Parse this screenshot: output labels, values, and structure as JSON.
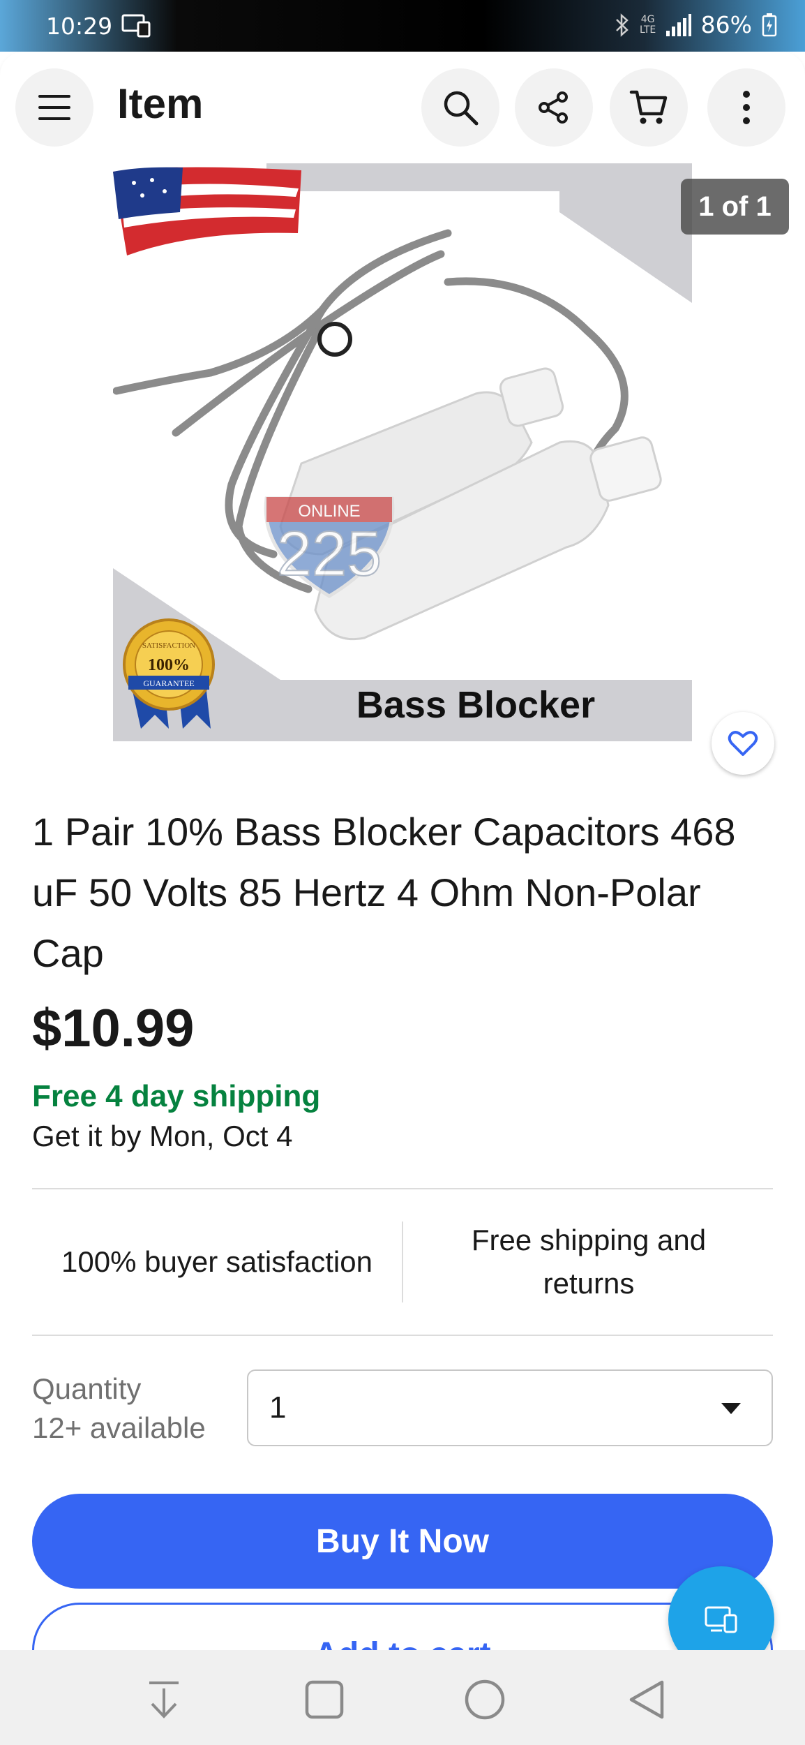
{
  "status_bar": {
    "time": "10:29",
    "network": "4G LTE",
    "battery": "86%"
  },
  "header": {
    "title": "Item",
    "icons": [
      "menu-icon",
      "search-icon",
      "share-icon",
      "cart-icon",
      "more-icon"
    ]
  },
  "gallery": {
    "counter": "1 of 1",
    "image_caption": "Bass Blocker",
    "watermark_top": "ONLINE",
    "watermark_number": "225",
    "seal_top": "SATISFACTION",
    "seal_middle": "100%",
    "seal_bottom": "GUARANTEE"
  },
  "listing": {
    "title": "1 Pair 10% Bass Blocker Capacitors 468 uF 50 Volts 85 Hertz 4 Ohm Non-Polar Cap",
    "price": "$10.99",
    "shipping": "Free 4 day shipping",
    "delivery": "Get it by Mon, Oct 4"
  },
  "badges": {
    "left": "100% buyer satisfaction",
    "right": "Free shipping and returns"
  },
  "quantity": {
    "label": "Quantity",
    "available": "12+ available",
    "value": "1"
  },
  "actions": {
    "buy_now": "Buy It Now",
    "add_to_cart": "Add to cart"
  },
  "colors": {
    "accent": "#3665f3",
    "shipping_green": "#05823f",
    "fab": "#1ea3e8"
  }
}
